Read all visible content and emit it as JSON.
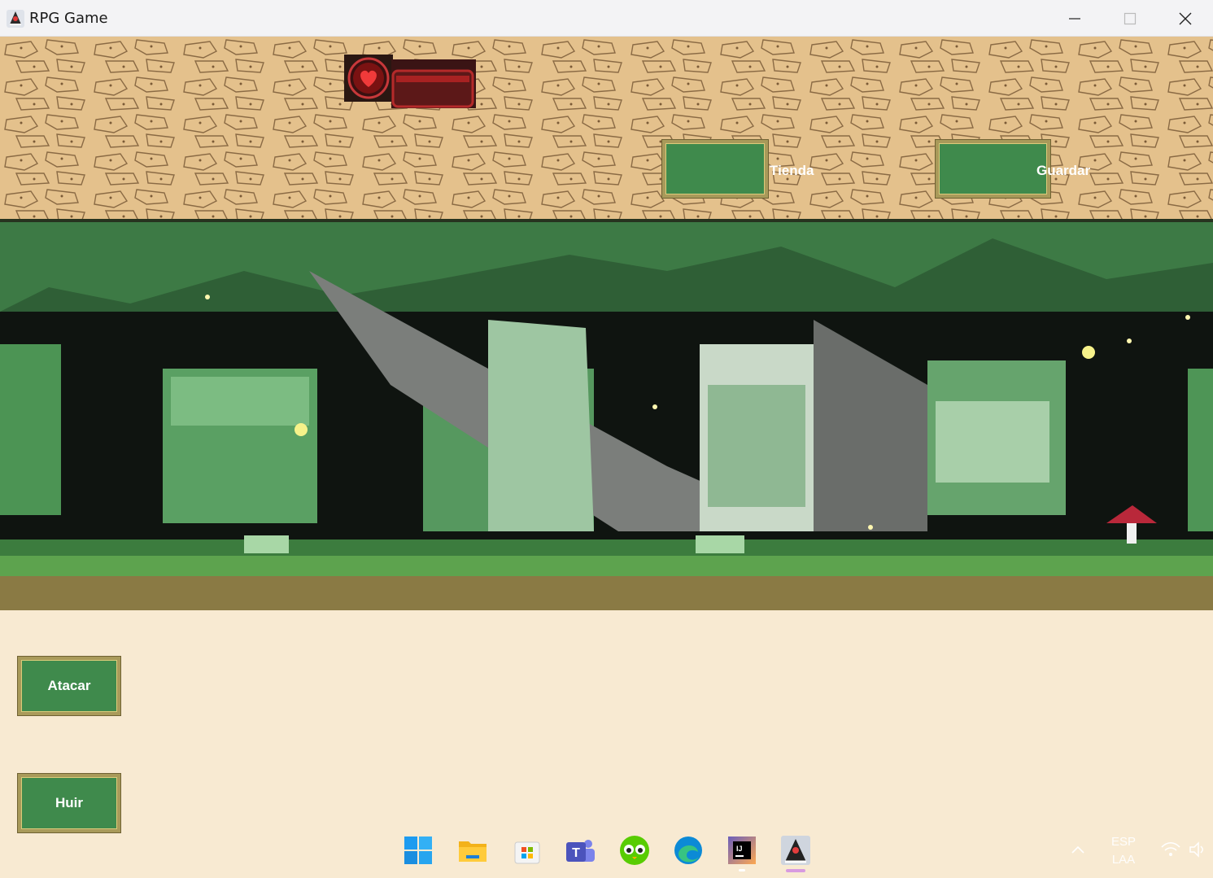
{
  "window": {
    "title": "RPG Game",
    "minimize_icon": "minimize-icon",
    "maximize_icon": "maximize-icon",
    "close_icon": "close-icon"
  },
  "hud": {
    "health_icon": "heart-icon",
    "shop_label": "Tienda",
    "save_label": "Guardar"
  },
  "actions": {
    "attack_label": "Atacar",
    "flee_label": "Huir"
  },
  "taskbar": {
    "apps": [
      "windows-start",
      "file-explorer",
      "microsoft-store",
      "teams",
      "duolingo",
      "edge",
      "intellij-idea",
      "java-app"
    ],
    "language_line1": "ESP",
    "language_line2": "LAA"
  },
  "colors": {
    "button_green": "#3f8a4c",
    "button_border": "#a99a5a",
    "hud_sand": "#e6c38e",
    "panel_cream": "#f8ead2"
  }
}
